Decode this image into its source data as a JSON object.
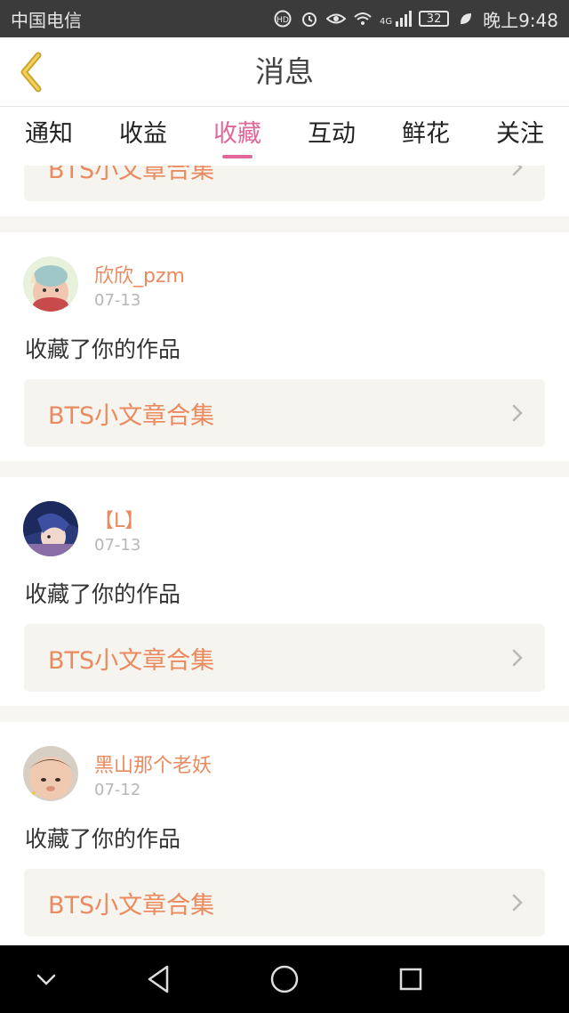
{
  "status_bar": {
    "carrier": "中国电信",
    "network": "4G",
    "battery": "32",
    "time": "晚上9:48"
  },
  "header": {
    "title": "消息",
    "back_icon": "chevron-left-icon"
  },
  "tabs": [
    {
      "label": "通知",
      "active": false
    },
    {
      "label": "收益",
      "active": false
    },
    {
      "label": "收藏",
      "active": true
    },
    {
      "label": "互动",
      "active": false
    },
    {
      "label": "鲜花",
      "active": false
    },
    {
      "label": "关注",
      "active": false
    }
  ],
  "partial_card": {
    "work_title": "BTS小文章合集"
  },
  "notifications": [
    {
      "username": "欣欣_pzm",
      "date": "07-13",
      "action": "收藏了你的作品",
      "work_title": "BTS小文章合集"
    },
    {
      "username": "【L】",
      "date": "07-13",
      "action": "收藏了你的作品",
      "work_title": "BTS小文章合集"
    },
    {
      "username": "黑山那个老妖",
      "date": "07-12",
      "action": "收藏了你的作品",
      "work_title": "BTS小文章合集"
    }
  ],
  "colors": {
    "accent": "#e0679a",
    "username": "#eb8a5f",
    "link_bg": "#f5f4ee",
    "separator": "#f7f6f2"
  },
  "nav_bar": [
    "chevron-down-icon",
    "back-triangle-icon",
    "home-circle-icon",
    "recents-square-icon"
  ]
}
